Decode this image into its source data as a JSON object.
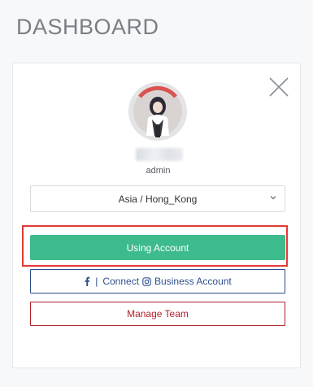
{
  "page": {
    "title": "DASHBOARD"
  },
  "profile": {
    "role": "admin",
    "avatar_icon": "user-avatar",
    "username_redacted": true
  },
  "timezone": {
    "selected": "Asia / Hong_Kong",
    "icon": "chevron-down-icon"
  },
  "actions": {
    "using_account_label": "Using Account",
    "connect_label_1": "Connect",
    "connect_label_2": "Business Account",
    "connect_separator": "|",
    "manage_team_label": "Manage Team"
  },
  "icons": {
    "close": "close-icon",
    "facebook": "facebook-icon",
    "instagram": "instagram-icon"
  },
  "colors": {
    "primary": "#3dbb8d",
    "connect": "#2f4f8e",
    "danger": "#b2212a",
    "highlight": "#e53935",
    "title": "#7a7f86"
  }
}
